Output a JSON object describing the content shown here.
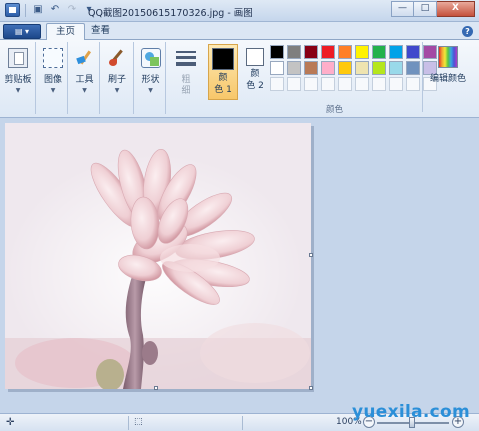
{
  "window": {
    "title": "QQ截图20150615170326.jpg - 画图",
    "controls": {
      "minimize": "—",
      "maximize": "□",
      "close": "X"
    }
  },
  "quick_access": {
    "icons": [
      "paint-app-icon",
      "save-icon",
      "undo-icon",
      "redo-icon",
      "customize-icon"
    ]
  },
  "tabs": [
    {
      "label": "主页",
      "active": true
    },
    {
      "label": "查看",
      "active": false
    }
  ],
  "ribbon": {
    "clipboard": {
      "label": "剪贴板"
    },
    "image": {
      "label": "图像"
    },
    "tools": {
      "label": "工具"
    },
    "brushes": {
      "label": "刷子"
    },
    "shapes": {
      "label": "形状"
    },
    "size": {
      "label": "粗\n细"
    },
    "color1": {
      "label": "颜\n色 1",
      "color": "#000000"
    },
    "color2": {
      "label": "颜\n色 2",
      "color": "#ffffff"
    },
    "palette_row1": [
      "#000000",
      "#7f7f7f",
      "#880015",
      "#ed1c24",
      "#ff7f27",
      "#fff200",
      "#22b14c",
      "#00a2e8",
      "#3f48cc",
      "#a349a4"
    ],
    "palette_row2": [
      "#ffffff",
      "#c3c3c3",
      "#b97a57",
      "#ffaec9",
      "#ffc90e",
      "#efe4b0",
      "#b5e61d",
      "#99d9ea",
      "#7092be",
      "#c8bfe7"
    ],
    "palette_row3_count": 10,
    "colors_group_label": "颜色",
    "edit_colors": {
      "label": "编辑颜色"
    }
  },
  "statusbar": {
    "zoom": "100%",
    "zoom_level": 1.0
  },
  "watermark": "yuexila.com"
}
